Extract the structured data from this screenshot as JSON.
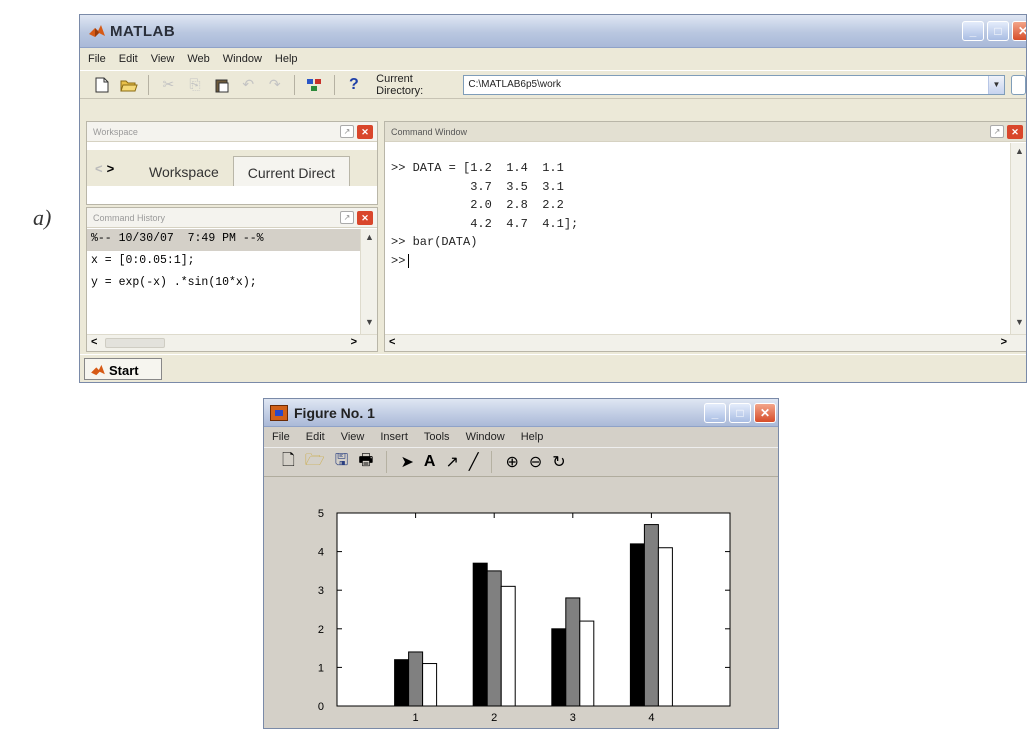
{
  "figure_label": "a)",
  "matlab": {
    "title": "MATLAB",
    "menu": [
      "File",
      "Edit",
      "View",
      "Web",
      "Window",
      "Help"
    ],
    "toolbar": {
      "icons": [
        "new-file-icon",
        "open-folder-icon",
        "cut-icon",
        "copy-icon",
        "paste-icon",
        "undo-icon",
        "redo-icon",
        "simulink-icon",
        "help-icon"
      ],
      "help_glyph": "?",
      "current_directory_label": "Current Directory:",
      "current_directory_value": "C:\\MATLAB6p5\\work"
    },
    "workspace": {
      "panel_title": "Workspace",
      "tabs": [
        "Workspace",
        "Current Direct"
      ]
    },
    "history": {
      "panel_title": "Command History",
      "lines": [
        "%-- 10/30/07  7:49 PM --%",
        "x = [0:0.05:1];",
        "y = exp(-x) .*sin(10*x);"
      ]
    },
    "command_window": {
      "panel_title": "Command Window",
      "lines": [
        ">> DATA = [1.2  1.4  1.1",
        "           3.7  3.5  3.1",
        "           2.0  2.8  2.2",
        "           4.2  4.7  4.1];",
        ">> bar(DATA)",
        ">>"
      ]
    },
    "taskbar": {
      "start_label": "Start"
    }
  },
  "figure": {
    "title": "Figure No. 1",
    "menu": [
      "File",
      "Edit",
      "View",
      "Insert",
      "Tools",
      "Window",
      "Help"
    ],
    "toolbar_icons": [
      "new-figure-icon",
      "open-icon",
      "save-icon",
      "print-icon",
      "arrow-select-icon",
      "text-insert-icon",
      "arrow-insert-icon",
      "line-insert-icon",
      "zoom-in-icon",
      "zoom-out-icon",
      "rotate-icon"
    ]
  },
  "chart_data": {
    "type": "bar",
    "categories": [
      "1",
      "2",
      "3",
      "4"
    ],
    "series": [
      {
        "values": [
          1.2,
          3.7,
          2.0,
          4.2
        ],
        "color": "#000000"
      },
      {
        "values": [
          1.4,
          3.5,
          2.8,
          4.7
        ],
        "color": "#808080"
      },
      {
        "values": [
          1.1,
          3.1,
          2.2,
          4.1
        ],
        "color": "#ffffff"
      }
    ],
    "ylim": [
      0,
      5
    ],
    "yticks": [
      0,
      1,
      2,
      3,
      4,
      5
    ],
    "grid": false
  }
}
